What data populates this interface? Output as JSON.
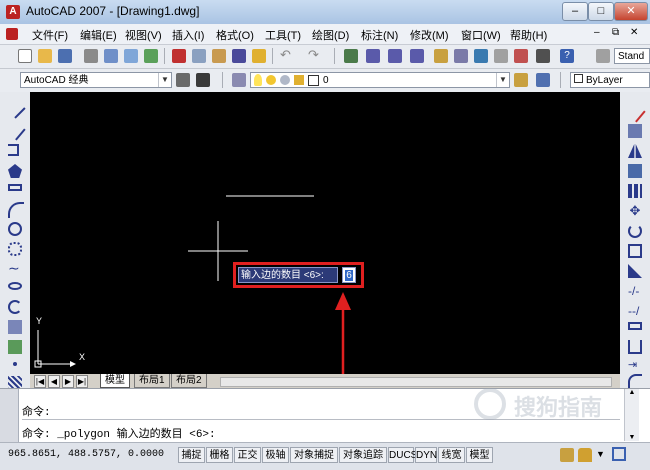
{
  "window": {
    "title": "AutoCAD 2007 - [Drawing1.dwg]",
    "minimize": "–",
    "maximize": "□",
    "close": "✕"
  },
  "menu": {
    "items": [
      "文件(F)",
      "编辑(E)",
      "视图(V)",
      "插入(I)",
      "格式(O)",
      "工具(T)",
      "绘图(D)",
      "标注(N)",
      "修改(M)",
      "窗口(W)",
      "帮助(H)"
    ],
    "doc_controls": [
      "–",
      "⧉",
      "✕"
    ]
  },
  "toolbar": {
    "style_combo": "Stand"
  },
  "workspace": {
    "value": "AutoCAD 经典"
  },
  "layer": {
    "value": "0"
  },
  "bylayer": {
    "value": "ByLayer"
  },
  "dynamic_input": {
    "prompt": "输入边的数目 <6>:",
    "value": "6"
  },
  "ucs": {
    "x_label": "X",
    "y_label": "Y"
  },
  "tabs": [
    "模型",
    "布局1",
    "布局2"
  ],
  "command": {
    "line1": "命令:",
    "line2": "命令: _polygon 输入边的数目 <6>:"
  },
  "status": {
    "coords": "965.8651,  488.5757, 0.0000",
    "buttons": [
      "捕捉",
      "栅格",
      "正交",
      "极轴",
      "对象捕捉",
      "对象追踪",
      "DUCS",
      "DYN",
      "线宽",
      "模型"
    ]
  },
  "watermark": {
    "text": "搜狗指南"
  },
  "colors": {
    "canvas": "#000000",
    "highlight": "#e02020",
    "prompt_bg": "#2c3a78"
  }
}
